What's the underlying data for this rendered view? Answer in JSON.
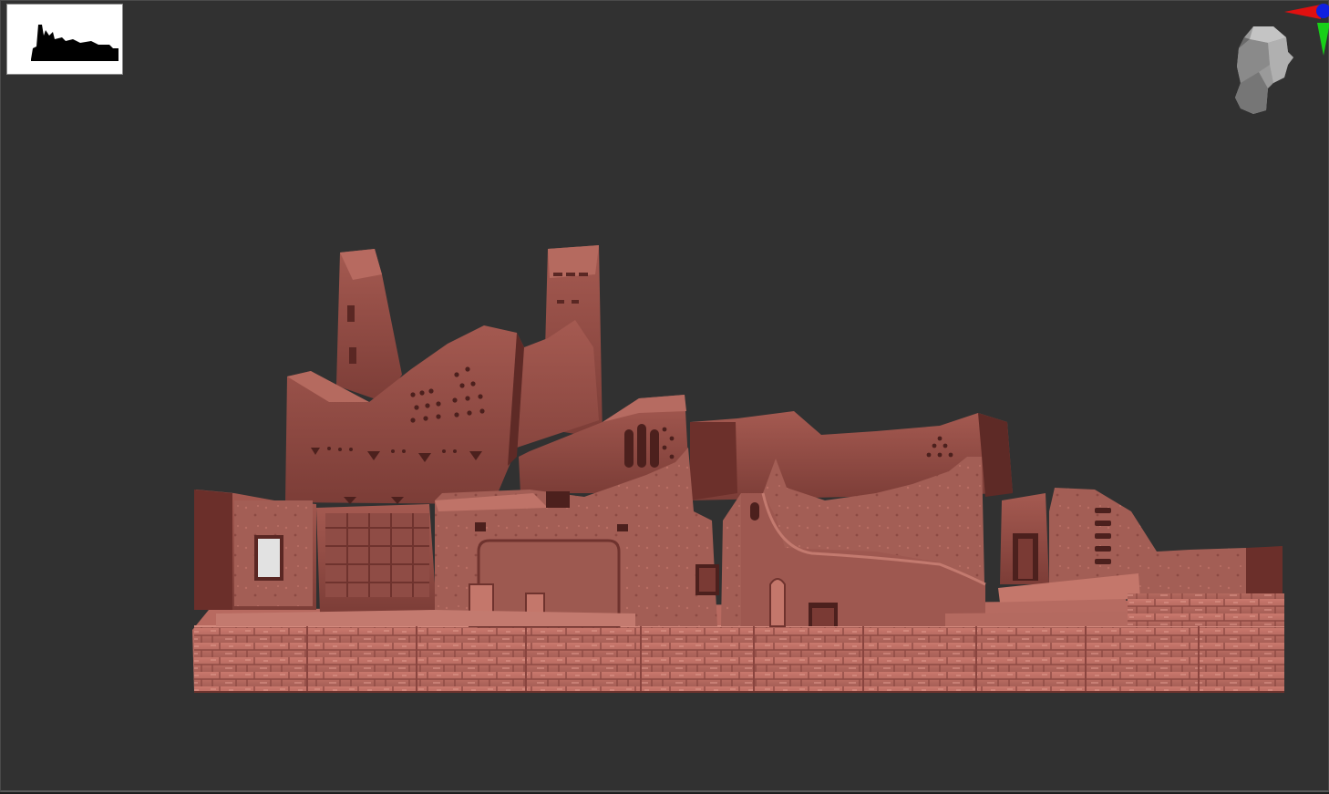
{
  "app": {
    "title": ""
  },
  "viewport": {
    "background_color": "#313131",
    "model_color": "#8e4a43",
    "model_highlight": "#c57a6f",
    "model_shadow": "#5c2a27",
    "model_subject": "adobe-ruins-sculpt"
  },
  "thumbnail": {
    "icon": "model-silhouette-icon",
    "background_color": "#ffffff",
    "silhouette_color": "#000000"
  },
  "navigation": {
    "icon": "orientation-head-icon",
    "axis_colors": {
      "x": "#e01010",
      "y": "#18d018",
      "z": "#1020e0"
    }
  }
}
